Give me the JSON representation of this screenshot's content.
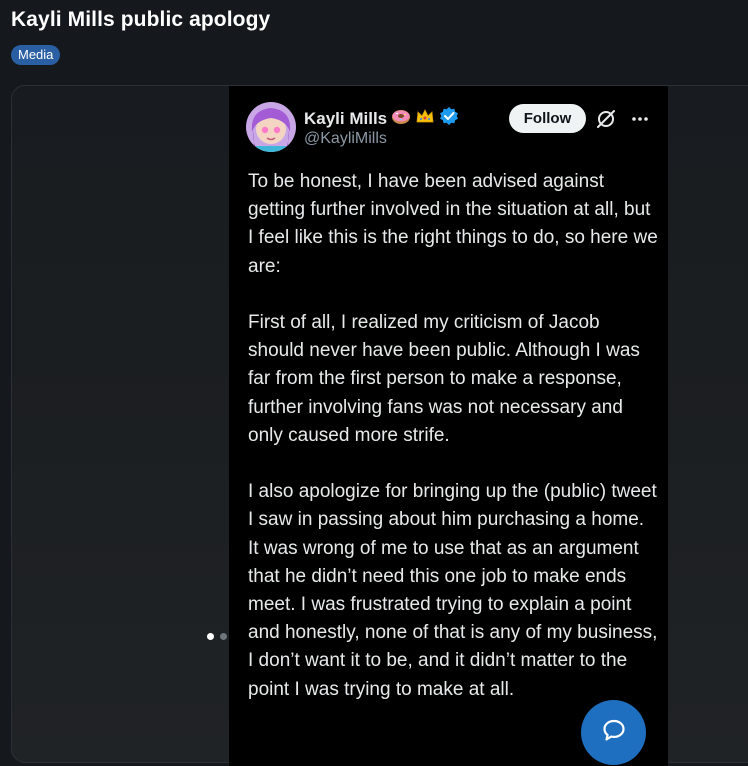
{
  "post": {
    "title": "Kayli Mills public apology",
    "flair": "Media"
  },
  "tweet": {
    "display_name": "Kayli Mills",
    "name_emojis": [
      "donut-emoji",
      "crown-emoji"
    ],
    "verified_badge": "verified-badge-icon",
    "handle": "@KayliMills",
    "follow_label": "Follow",
    "paragraphs": [
      "To be honest, I have been advised against getting further involved in the situation at all, but I feel like this is the right things to do, so here we are:",
      "First of all, I realized my criticism of Jacob should never have been public. Although I was far from the first person to make a response, further involving fans was not necessary and only caused more strife.",
      "I also apologize for bringing up the (public) tweet I saw in passing about him purchasing a home. It was wrong of me to use that as an argument that he didn’t need this one job to make ends meet. I was frustrated trying to explain a point and honestly, none of that is any of my business, I don’t want it to be, and it didn’t matter to the point I was trying to make at all."
    ],
    "carousel": {
      "current": 1,
      "total": 2
    }
  },
  "colors": {
    "flair_bg": "#2b5fa3",
    "verified_blue": "#1d9bf0",
    "fab_blue": "#1e6fbf"
  },
  "icons": {
    "more": "more-horizontal-icon",
    "grok": "grok-icon",
    "chat": "chat-bubble-icon"
  }
}
